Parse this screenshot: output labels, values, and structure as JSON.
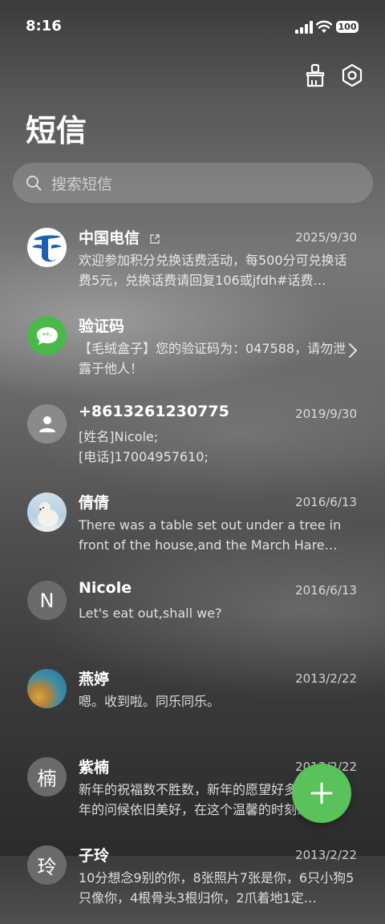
{
  "status_bar": {
    "time": "8:16",
    "battery": "100"
  },
  "header": {
    "title": "短信"
  },
  "search": {
    "placeholder": "搜索短信"
  },
  "conversations": [
    {
      "name": "中国电信",
      "date": "2025/9/30",
      "preview": "欢迎参加积分兑换话费活动，每500分可兑换话费5元，兑换话费请回复106或jfdh#话费…",
      "avatar": "china-telecom-logo"
    },
    {
      "name": "验证码",
      "date": "",
      "preview": "【毛绒盒子】您的验证码为：047588，请勿泄露于他人！",
      "avatar": "message-icon"
    },
    {
      "name": "+8613261230775",
      "date": "2019/9/30",
      "preview": "[姓名]Nicole;\n[电话]17004957610;",
      "avatar": "person-icon"
    },
    {
      "name": "倩倩",
      "date": "2016/6/13",
      "preview": "There was a table set out under a tree in front of the house,and the March Hare an…",
      "avatar": "polar-bear-photo"
    },
    {
      "name": "Nicole",
      "date": "2016/6/13",
      "preview": "Let's eat out,shall we?",
      "avatar_letter": "N"
    },
    {
      "name": "燕婷",
      "date": "2013/2/22",
      "preview": "嗯。收到啦。同乐同乐。",
      "avatar": "ocean-photo"
    },
    {
      "name": "紫楠",
      "date": "2013/2/22",
      "preview": "新年的祝福数不胜数，新年的愿望好多好多，新年的问候依旧美好，在这个温馨的时刻…",
      "avatar_letter": "楠"
    },
    {
      "name": "子玲",
      "date": "2013/2/22",
      "preview": "10分想念9别的你，8张照片7张是你，6只小狗5只像你，4根骨头3根归你，2爪着地1定…",
      "avatar_letter": "玲"
    }
  ],
  "colors": {
    "fab": "#59c25a",
    "telecom_blue": "#1b5fb5",
    "message_green": "#4cb84c"
  }
}
